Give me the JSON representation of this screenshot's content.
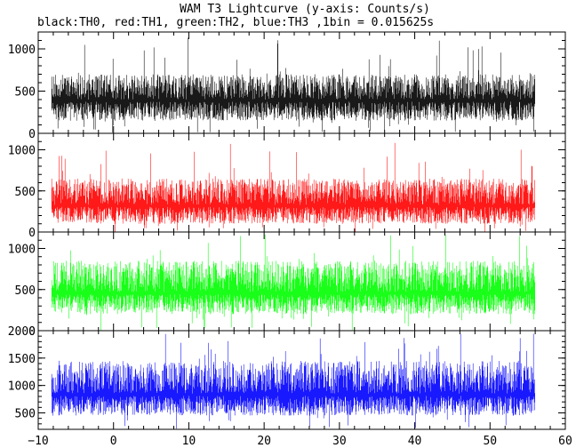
{
  "figure": {
    "title": "WAM T3 Lightcurve (y-axis: Counts/s)",
    "subtitle": "black:TH0, red:TH1, green:TH2, blue:TH3 ,1bin = 0.015625s"
  },
  "chart_data": [
    {
      "type": "line",
      "series": [
        {
          "name": "TH0",
          "color": "#000000"
        }
      ],
      "data_range_x": [
        -8.2,
        56.0
      ],
      "mean": 400,
      "band_low": 150,
      "band_high": 700,
      "spike_max": 1140,
      "floor": 0,
      "xlim": [
        -10,
        60
      ],
      "ylim": [
        0,
        1200
      ],
      "yticks": [
        0,
        500,
        1000
      ],
      "ytick_labels": [
        "0",
        "500",
        "1000"
      ]
    },
    {
      "type": "line",
      "series": [
        {
          "name": "TH1",
          "color": "#ff0000"
        }
      ],
      "data_range_x": [
        -8.2,
        56.0
      ],
      "mean": 330,
      "band_low": 100,
      "band_high": 650,
      "spike_max": 1100,
      "floor": 0,
      "xlim": [
        -10,
        60
      ],
      "ylim": [
        0,
        1200
      ],
      "yticks": [
        0,
        500,
        1000
      ],
      "ytick_labels": [
        "0",
        "500",
        "1000"
      ]
    },
    {
      "type": "line",
      "series": [
        {
          "name": "TH2",
          "color": "#00ff00"
        }
      ],
      "data_range_x": [
        -8.2,
        56.0
      ],
      "mean": 470,
      "band_low": 200,
      "band_high": 850,
      "spike_max": 1200,
      "floor": 0,
      "xlim": [
        -10,
        60
      ],
      "ylim": [
        0,
        1200
      ],
      "yticks": [
        0,
        500,
        1000
      ],
      "ytick_labels": [
        "0",
        "500",
        "1000"
      ]
    },
    {
      "type": "line",
      "series": [
        {
          "name": "TH3",
          "color": "#0000ff"
        }
      ],
      "data_range_x": [
        -8.2,
        56.0
      ],
      "mean": 850,
      "band_low": 450,
      "band_high": 1450,
      "spike_max": 1950,
      "floor": 200,
      "xlim": [
        -10,
        60
      ],
      "ylim": [
        200,
        2000
      ],
      "yticks": [
        500,
        1000,
        1500,
        2000
      ],
      "ytick_labels": [
        "500",
        "1000",
        "1500",
        "2000"
      ],
      "xlabel_ticks": [
        -10,
        0,
        10,
        20,
        30,
        40,
        50,
        60
      ],
      "xtick_labels": [
        "−10",
        "0",
        "10",
        "20",
        "30",
        "40",
        "50",
        "60"
      ]
    }
  ]
}
